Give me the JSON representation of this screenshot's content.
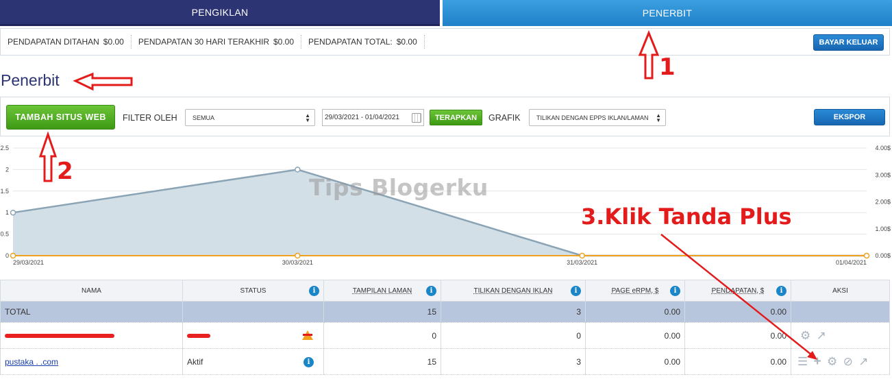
{
  "tabs": {
    "advertiser": "PENGIKLAN",
    "publisher": "PENERBIT"
  },
  "earnings": {
    "held_label": "PENDAPATAN DITAHAN",
    "held_value": "$0.00",
    "last30_label": "PENDAPATAN 30 HARI TERAKHIR",
    "last30_value": "$0.00",
    "total_label": "PENDAPATAN TOTAL:",
    "total_value": "$0.00",
    "payout_button": "BAYAR KELUAR"
  },
  "page_title": "Penerbit",
  "toolbar": {
    "add_site_button": "TAMBAH SITUS WEB",
    "filter_label": "FILTER OLEH",
    "filter_value": "SEMUA",
    "date_range": "29/03/2021 - 01/04/2021",
    "apply_button": "TERAPKAN",
    "chart_label": "GRAFIK",
    "chart_value": "TILIKAN DENGAN EPPS IKLAN/LAMAN",
    "export_button": "EKSPOR"
  },
  "chart_data": {
    "type": "area",
    "x": [
      "29/03/2021",
      "30/03/2021",
      "31/03/2021",
      "01/04/2021"
    ],
    "series": [
      {
        "values": [
          1,
          2,
          0,
          0
        ],
        "axis": "left",
        "color": "#8aa4b5",
        "fill": "#d3dfe6"
      },
      {
        "values": [
          0,
          0,
          0,
          0
        ],
        "axis": "right",
        "color": "#f0a21e"
      }
    ],
    "y_left": {
      "ticks": [
        "0",
        "0.5",
        "1",
        "1.5",
        "2",
        "2.5"
      ],
      "lim": [
        0,
        2.5
      ]
    },
    "y_right": {
      "ticks": [
        "0.00$",
        "1.00$",
        "2.00$",
        "3.00$",
        "4.00$"
      ],
      "lim": [
        0,
        4
      ]
    },
    "grid": true
  },
  "table": {
    "headers": [
      "NAMA",
      "STATUS",
      "TAMPILAN LAMAN",
      "TILIKAN DENGAN IKLAN",
      "PAGE eRPM, $",
      "PENDAPATAN, $",
      "AKSI"
    ],
    "total": {
      "name": "TOTAL",
      "pageviews": "15",
      "views": "3",
      "erpm": "0.00",
      "revenue": "0.00"
    },
    "rows": [
      {
        "name": "",
        "status": "",
        "pageviews": "0",
        "views": "0",
        "erpm": "0.00",
        "revenue": "0.00"
      },
      {
        "name": "pustaka  .  .com",
        "status": "Aktif",
        "pageviews": "15",
        "views": "3",
        "erpm": "0.00",
        "revenue": "0.00"
      }
    ]
  },
  "annotations": {
    "one": "1",
    "two": "2",
    "three": "3.Klik Tanda Plus",
    "watermark": "Tips Blogerku"
  },
  "colors": {
    "navy": "#2c3473",
    "blue": "#1f80c8",
    "green": "#3e9a14",
    "red": "#e31b1b"
  }
}
